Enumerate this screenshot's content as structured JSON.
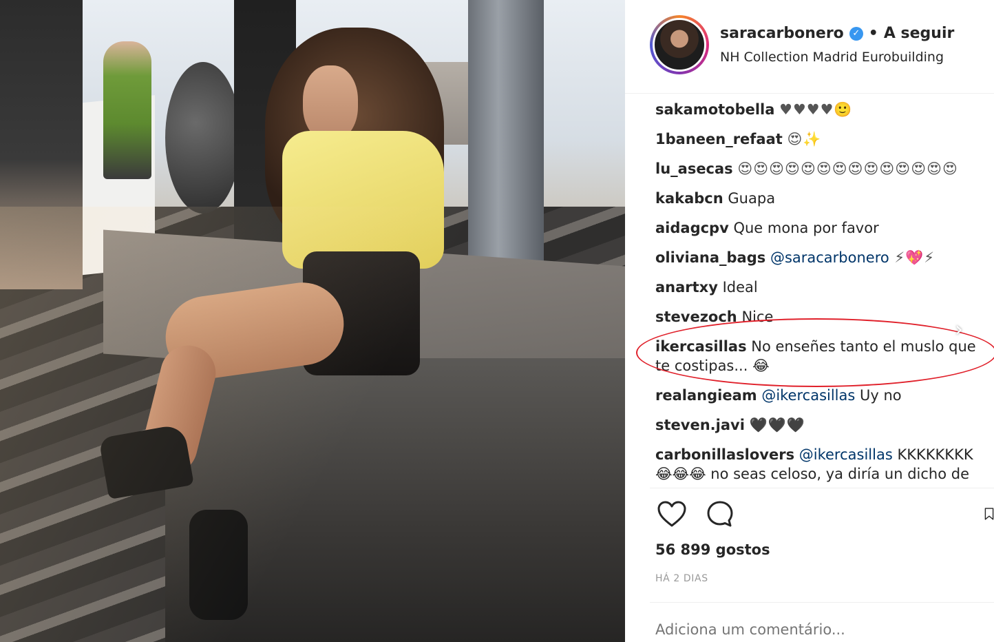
{
  "post": {
    "username": "saracarbonero",
    "follow_separator": "•",
    "follow_label": "A seguir",
    "location": "NH Collection Madrid Eurobuilding"
  },
  "comments": [
    {
      "user": "sakamotobella",
      "parts": [
        {
          "type": "emoji",
          "text": "♥♥♥♥🙂"
        }
      ]
    },
    {
      "user": "1baneen_refaat",
      "parts": [
        {
          "type": "emoji",
          "text": "😍✨"
        }
      ]
    },
    {
      "user": "lu_asecas",
      "parts": [
        {
          "type": "emoji",
          "text": "😍😍😍😍😍😍😍😍😍😍😍😍😍😍"
        }
      ]
    },
    {
      "user": "kakabcn",
      "parts": [
        {
          "type": "text",
          "text": "Guapa"
        }
      ]
    },
    {
      "user": "aidagcpv",
      "parts": [
        {
          "type": "text",
          "text": "Que mona por favor"
        }
      ]
    },
    {
      "user": "oliviana_bags",
      "parts": [
        {
          "type": "mention",
          "text": "@saracarbonero"
        },
        {
          "type": "emoji",
          "text": " ⚡💖⚡"
        }
      ]
    },
    {
      "user": "anartxy",
      "parts": [
        {
          "type": "text",
          "text": "Ideal"
        }
      ]
    },
    {
      "user": "stevezoch",
      "parts": [
        {
          "type": "text",
          "text": "Nice"
        }
      ]
    },
    {
      "user": "ikercasillas",
      "parts": [
        {
          "type": "text",
          "text": "No enseñes tanto el muslo que te costipas... 😂"
        }
      ]
    },
    {
      "user": "realangieam",
      "parts": [
        {
          "type": "mention",
          "text": "@ikercasillas"
        },
        {
          "type": "text",
          "text": " Uy no"
        }
      ]
    },
    {
      "user": "steven.javi",
      "parts": [
        {
          "type": "emoji",
          "text": "🖤🖤🖤"
        }
      ]
    },
    {
      "user": "carbonillaslovers",
      "parts": [
        {
          "type": "mention",
          "text": "@ikercasillas"
        },
        {
          "type": "text",
          "text": " KKKKKKKK 😂😂😂 no seas celoso, ya diría un dicho de"
        }
      ]
    }
  ],
  "actions": {
    "likes": "56 899 gostos",
    "time": "HÁ 2 DIAS",
    "icons": [
      "heart-icon",
      "comment-icon",
      "bookmark-icon"
    ]
  },
  "add_comment_placeholder": "Adiciona um comentário...",
  "colors": {
    "highlight": "#e0202a",
    "verified": "#3897f0",
    "mention": "#003569"
  }
}
